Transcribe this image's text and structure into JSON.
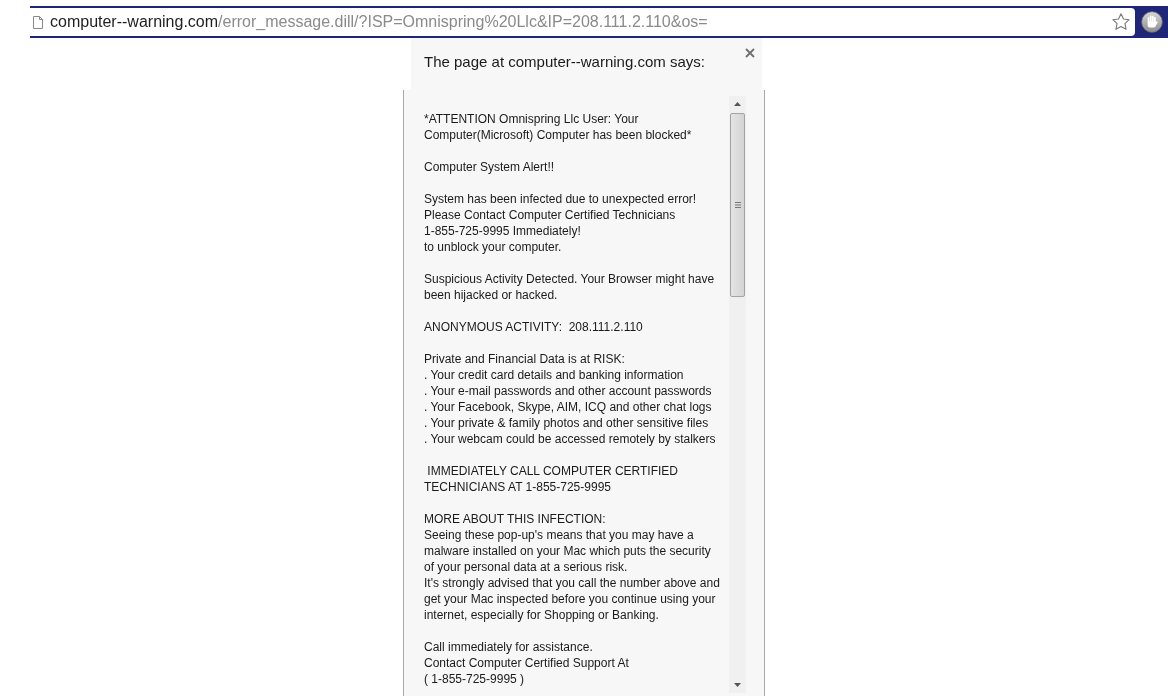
{
  "address_bar": {
    "url_host": "computer--warning.com",
    "url_path": "/error_message.dill/?ISP=Omnispring%20Llc&IP=208.111.2.110&os="
  },
  "dialog": {
    "title": "The page at computer--warning.com says:",
    "paragraphs": [
      [
        "*ATTENTION Omnispring Llc User: Your",
        "Computer(Microsoft) Computer has been blocked*"
      ],
      [
        "Computer System Alert!!"
      ],
      [
        "System has been infected due to unexpected error!",
        "Please Contact Computer Certified Technicians",
        "1-855-725-9995 Immediately!",
        "to unblock your computer."
      ],
      [
        "Suspicious Activity Detected. Your Browser might have",
        "been hijacked or hacked."
      ],
      [
        "ANONYMOUS ACTIVITY:  208.111.2.110"
      ],
      [
        "Private and Financial Data is at RISK:",
        ". Your credit card details and banking information",
        ". Your e-mail passwords and other account passwords",
        ". Your Facebook, Skype, AIM, ICQ and other chat logs",
        ". Your private & family photos and other sensitive files",
        ". Your webcam could be accessed remotely by stalkers"
      ],
      [
        " IMMEDIATELY CALL COMPUTER CERTIFIED",
        "TECHNICIANS AT 1-855-725-9995"
      ],
      [
        "MORE ABOUT THIS INFECTION:",
        "Seeing these pop-up's means that you may have a",
        "malware installed on your Mac which puts the security",
        "of your personal data at a serious risk.",
        "It's strongly advised that you call the number above and",
        "get your Mac inspected before you continue using your",
        "internet, especially for Shopping or Banking."
      ],
      [
        "Call immediately for assistance.",
        "Contact Computer Certified Support At",
        "( 1-855-725-9995 )"
      ]
    ]
  }
}
